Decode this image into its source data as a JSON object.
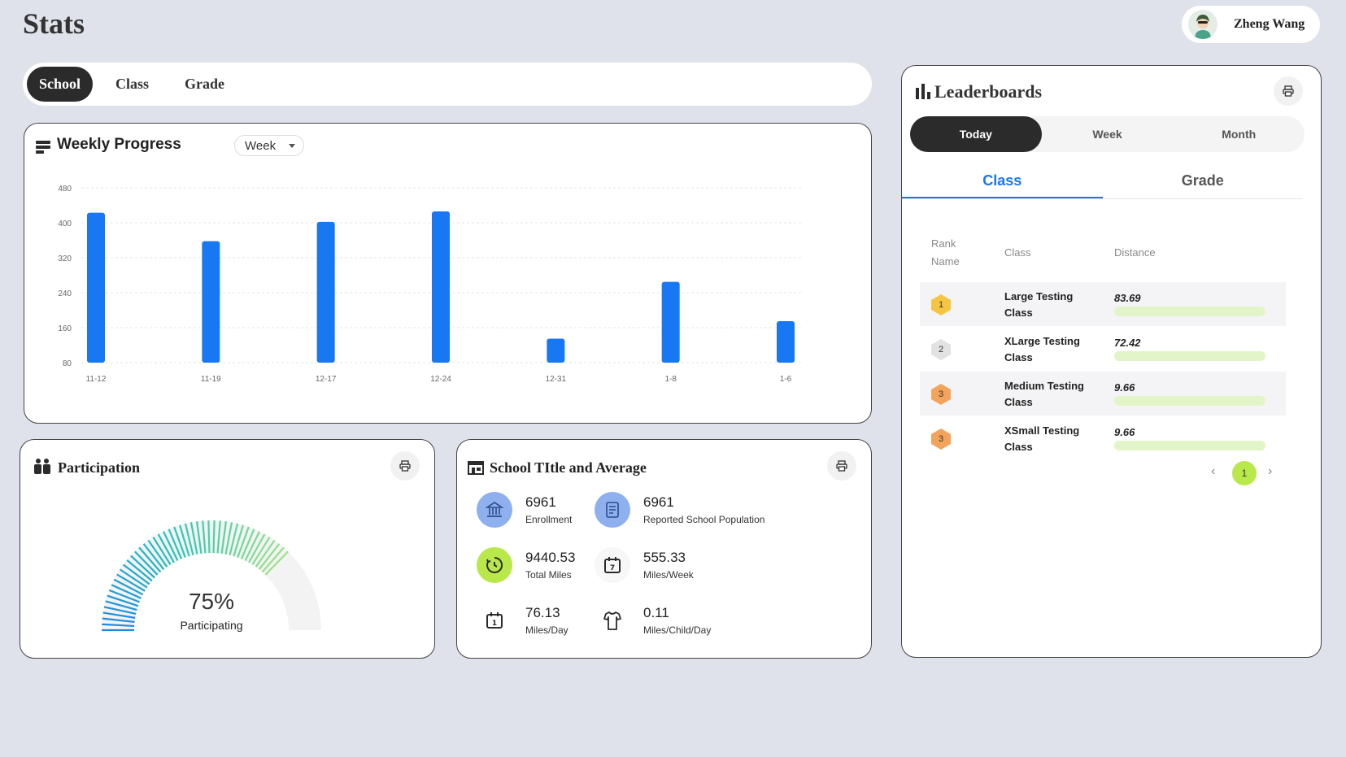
{
  "page": {
    "title": "Stats"
  },
  "user": {
    "name": "Zheng Wang"
  },
  "scope_tabs": [
    {
      "label": "School",
      "active": true
    },
    {
      "label": "Class",
      "active": false
    },
    {
      "label": "Grade",
      "active": false
    }
  ],
  "weekly": {
    "title": "Weekly Progress",
    "range": "Week"
  },
  "chart_data": {
    "type": "bar",
    "categories": [
      "11-12",
      "11-19",
      "12-17",
      "12-24",
      "12-31",
      "1-8",
      "1-6"
    ],
    "values": [
      423,
      358,
      402,
      426,
      135,
      265,
      175
    ],
    "ylim": [
      80,
      480
    ],
    "yticks": [
      80,
      160,
      240,
      320,
      400,
      480
    ],
    "grid": true,
    "color": "#1877f2"
  },
  "participation": {
    "title": "Participation",
    "value": "75%",
    "label": "Participating",
    "fraction": 0.75
  },
  "school": {
    "title": "School TItle and Average",
    "stats": [
      {
        "value": "6961",
        "label": "Enrollment",
        "icon": "school-building-icon"
      },
      {
        "value": "6961",
        "label": "Reported School Population",
        "icon": "document-icon"
      },
      {
        "value": "9440.53",
        "label": "Total Miles",
        "icon": "timer-icon"
      },
      {
        "value": "555.33",
        "label": "Miles/Week",
        "icon": "calendar-7-icon"
      },
      {
        "value": "76.13",
        "label": "Miles/Day",
        "icon": "calendar-1-icon"
      },
      {
        "value": "0.11",
        "label": "Miles/Child/Day",
        "icon": "child-shirt-icon"
      }
    ]
  },
  "leaderboard": {
    "title": "Leaderboards",
    "periods": [
      {
        "label": "Today",
        "active": true
      },
      {
        "label": "Week",
        "active": false
      },
      {
        "label": "Month",
        "active": false
      }
    ],
    "views": [
      {
        "label": "Class",
        "active": true
      },
      {
        "label": "Grade",
        "active": false
      }
    ],
    "headers": {
      "rank": "Rank",
      "name": "Name",
      "class": "Class",
      "distance": "Distance"
    },
    "rows": [
      {
        "rank": "1",
        "class": "Large Testing Class",
        "distance": "83.69",
        "badge_color": "#f5c542"
      },
      {
        "rank": "2",
        "class": "XLarge Testing Class",
        "distance": "72.42",
        "badge_color": "#e2e2e2"
      },
      {
        "rank": "3",
        "class": "Medium Testing Class",
        "distance": "9.66",
        "badge_color": "#f3a35c"
      },
      {
        "rank": "3",
        "class": "XSmall Testing Class",
        "distance": "9.66",
        "badge_color": "#f3a35c"
      }
    ],
    "page": "1"
  },
  "colors": {
    "accent": "#1877f2",
    "lime": "#b9e84a"
  }
}
